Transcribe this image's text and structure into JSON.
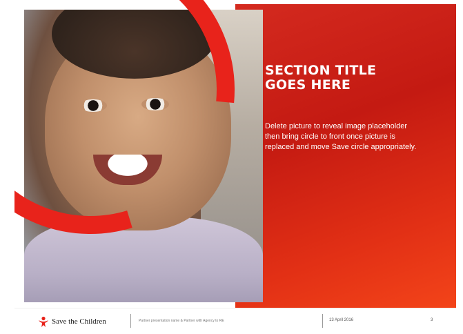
{
  "slide": {
    "section_title_line1": "SECTION TITLE",
    "section_title_line2": "GOES HERE",
    "body_text": "Delete picture to reveal image placeholder then bring circle to front once picture is replaced and move Save circle appropriately."
  },
  "footer": {
    "brand_name": "Save the Children",
    "presentation_title": "Partner presentation name & Partner with Agency to RE",
    "date": "13 April 2016",
    "page_number": "3"
  },
  "colors": {
    "accent_red": "#d42a1f",
    "ring_red": "#e8231b"
  }
}
